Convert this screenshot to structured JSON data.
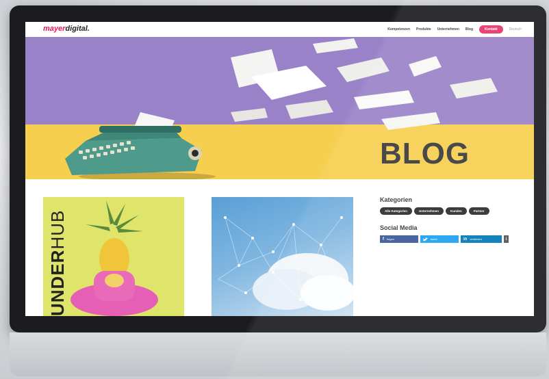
{
  "nav": {
    "logo_part1": "mayer",
    "logo_part2": "digital.",
    "items": [
      "Kompetenzen",
      "Produkte",
      "Unternehmen",
      "Blog"
    ],
    "cta": "Kontakt",
    "language": "Deutsch"
  },
  "hero": {
    "title": "BLOG"
  },
  "posts": [
    {
      "image_text_bold": "UNDER",
      "image_text_thin": "HUB"
    },
    {}
  ],
  "sidebar": {
    "categories_heading": "Kategorien",
    "tags": [
      "Alle Kategorien",
      "Unternehmen",
      "Kunden",
      "Partner"
    ],
    "social_heading": "Social Media",
    "social": [
      {
        "network": "facebook",
        "icon": "f",
        "label": "folgen"
      },
      {
        "network": "twitter",
        "icon": "twitter-bird",
        "label": "tweet"
      },
      {
        "network": "linkedin",
        "icon": "in",
        "label": "verbinden"
      }
    ],
    "more_icon": "i"
  },
  "colors": {
    "brand": "#e2195b",
    "hero_purple": "#9a82c8",
    "hero_yellow": "#f6cf4f",
    "facebook": "#3b5998",
    "twitter": "#1da1f2",
    "linkedin": "#0077b5"
  }
}
